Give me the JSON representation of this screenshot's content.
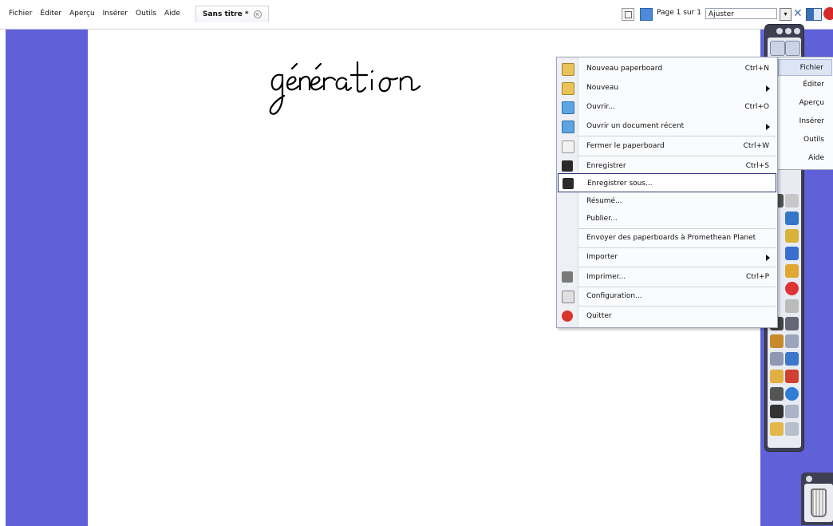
{
  "menubar": {
    "items": [
      "Fichier",
      "Éditer",
      "Aperçu",
      "Insérer",
      "Outils",
      "Aide"
    ]
  },
  "document_tab": {
    "title": "Sans titre *"
  },
  "page_nav": {
    "label": "Page 1 sur 1",
    "zoom": "Ajuster"
  },
  "canvas": {
    "handwriting": "génération"
  },
  "file_menu": {
    "items": [
      {
        "label": "Nouveau paperboard",
        "shortcut": "Ctrl+N",
        "icon": "new-flipchart-icon"
      },
      {
        "label": "Nouveau",
        "shortcut": "",
        "icon": "new-icon",
        "submenu": true
      },
      {
        "label": "Ouvrir...",
        "shortcut": "Ctrl+O",
        "icon": "open-icon"
      },
      {
        "label": "Ouvrir un document récent",
        "shortcut": "",
        "icon": "open-recent-icon",
        "submenu": true
      },
      {
        "label": "Fermer le paperboard",
        "shortcut": "Ctrl+W",
        "icon": "close-flipchart-icon"
      },
      {
        "label": "Enregistrer",
        "shortcut": "Ctrl+S",
        "icon": "save-icon"
      },
      {
        "label": "Enregistrer sous...",
        "shortcut": "",
        "icon": "save-as-icon"
      },
      {
        "label": "Résumé...",
        "shortcut": "",
        "icon": ""
      },
      {
        "label": "Publier...",
        "shortcut": "",
        "icon": ""
      },
      {
        "label": "Envoyer des paperboards à Promethean Planet",
        "shortcut": "",
        "icon": ""
      },
      {
        "label": "Importer",
        "shortcut": "",
        "icon": "",
        "submenu": true
      },
      {
        "label": "Imprimer...",
        "shortcut": "Ctrl+P",
        "icon": "print-icon"
      },
      {
        "label": "Configuration...",
        "shortcut": "",
        "icon": "settings-icon"
      },
      {
        "label": "Quitter",
        "shortcut": "",
        "icon": "quit-icon"
      }
    ]
  },
  "toolbox_menu": {
    "items": [
      "Fichier",
      "Éditer",
      "Aperçu",
      "Insérer",
      "Outils",
      "Aide"
    ]
  },
  "colors": {
    "gutter": "#6060d8",
    "toolbox": "#3f3f52"
  }
}
